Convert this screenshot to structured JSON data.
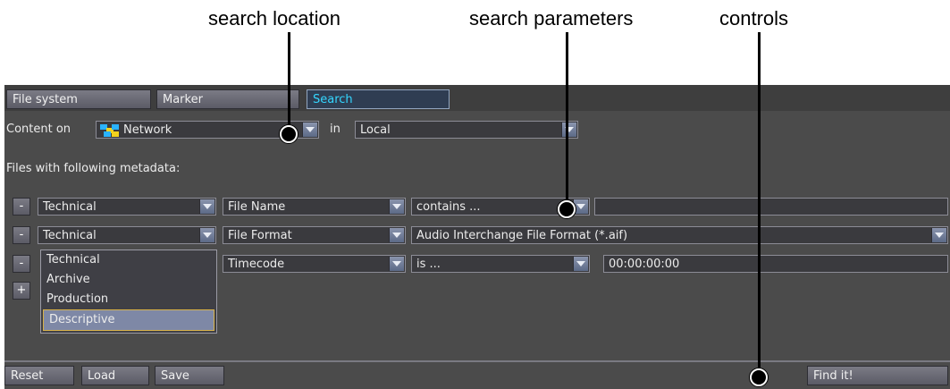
{
  "callouts": {
    "location": "search location",
    "parameters": "search parameters",
    "controls": "controls"
  },
  "tabs": [
    {
      "label": "File system"
    },
    {
      "label": "Marker"
    },
    {
      "label": "Search"
    }
  ],
  "content_row": {
    "label": "Content on",
    "source_value": "Network",
    "in_label": "in",
    "location_value": "Local"
  },
  "metadata_label": "Files with following metadata:",
  "rows": [
    {
      "remove": "-",
      "category": "Technical",
      "field": "File Name",
      "operator": "contains ...",
      "value": ""
    },
    {
      "remove": "-",
      "category": "Technical",
      "field": "File Format",
      "operator": "Audio Interchange File Format (*.aif)",
      "value": ""
    },
    {
      "remove": "-",
      "category": "Technical",
      "field": "Timecode",
      "operator": "is ...",
      "value": "00:00:00:00"
    }
  ],
  "add_label": "+",
  "category_options": [
    "Technical",
    "Archive",
    "Production",
    "Descriptive"
  ],
  "selected_option": "Descriptive",
  "footer": {
    "reset": "Reset",
    "load": "Load",
    "save": "Save",
    "find": "Find it!"
  },
  "icons": {
    "network": "network-icon",
    "dropdown": "chevron-down-icon"
  },
  "colors": {
    "panel": "#4b4b4b",
    "active_tab_text": "#34d6ff",
    "highlight": "#7e88a6"
  }
}
